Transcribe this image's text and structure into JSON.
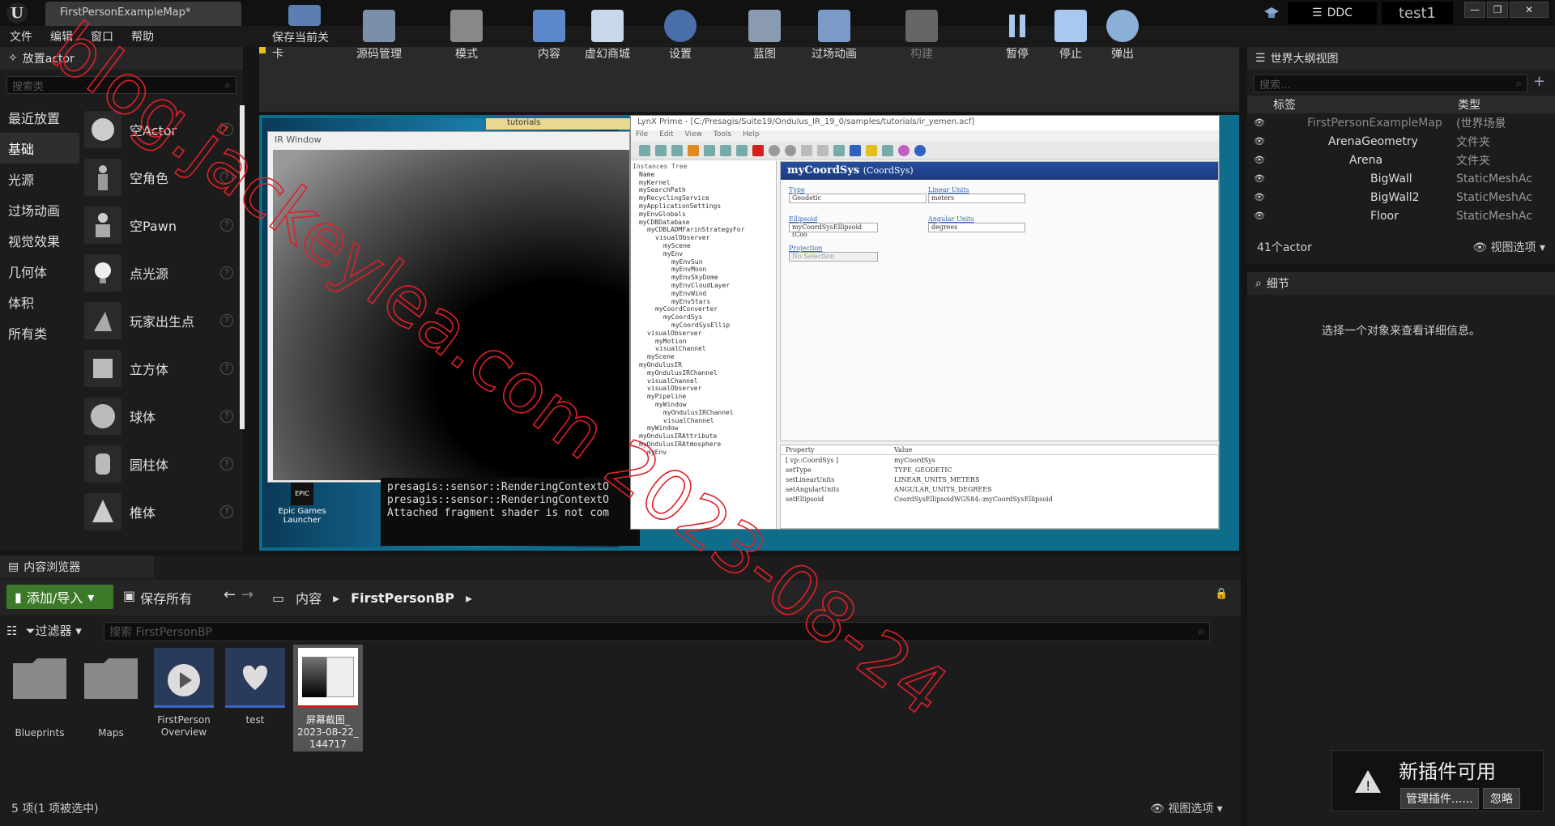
{
  "window": {
    "tab_title": "FirstPersonExampleMap*",
    "ddc": "DDC",
    "project": "test1"
  },
  "menu": [
    "文件",
    "编辑",
    "窗口",
    "帮助"
  ],
  "place_actor": {
    "tab": "放置actor",
    "search_placeholder": "搜索类",
    "categories": [
      "最近放置",
      "基础",
      "光源",
      "过场动画",
      "视觉效果",
      "几何体",
      "体积",
      "所有类"
    ],
    "selected_category": "基础",
    "actors": [
      "空Actor",
      "空角色",
      "空Pawn",
      "点光源",
      "玩家出生点",
      "立方体",
      "球体",
      "圆柱体",
      "椎体"
    ]
  },
  "toolbar": [
    "保存当前关卡",
    "源码管理",
    "模式",
    "内容",
    "虚幻商城",
    "设置",
    "蓝图",
    "过场动画",
    "构建",
    "暂停",
    "停止",
    "弹出"
  ],
  "viewport": {
    "desktop_tabs": [
      "tutorials"
    ],
    "ir_window_title": "IR Window",
    "epic_label": "Epic Games Launcher",
    "console_lines": [
      "presagis::sensor::RenderingContextO",
      "presagis::sensor::RenderingContextO",
      "Attached fragment shader is not com"
    ]
  },
  "lynx": {
    "title": "LynX Prime - [C:/Presagis/Suite19/Ondulus_IR_19_0/samples/tutorials/ir_yemen.acf]",
    "menu": [
      "File",
      "Edit",
      "View",
      "Tools",
      "Help"
    ],
    "tree_header": "Instances Tree",
    "tree": [
      "Name",
      "myKernel",
      "mySearchPath",
      "myRecyclingService",
      "myApplicationSettings",
      "myEnvGlobals",
      "myCDBDatabase",
      " myCDBLADMFarinStrategyFor",
      "  visualObserver",
      "   myScene",
      "   myEnv",
      "    myEnvSun",
      "    myEnvMoon",
      "    myEnvSkyDome",
      "    myEnvCloudLayer",
      "    myEnvWind",
      "    myEnvStars",
      "  myCoordConverter",
      "   myCoordSys",
      "    myCoordSysEllip",
      " visualObserver",
      "  myMotion",
      "  visualChannel",
      " myScene",
      "myOndulusIR",
      " myOndulusIRChannel",
      " visualChannel",
      " visualObserver",
      " myPipeline",
      "  myWindow",
      "   myOndulusIRChannel",
      "   visualChannel",
      " myWindow",
      "myOndulusIRAttribute",
      "myOndulusIRAtmosphere",
      " myEnv"
    ],
    "props_title": "myCoordSys",
    "props_type": "(CoordSys)",
    "fields": [
      {
        "label": "Type",
        "value": "Geodetic"
      },
      {
        "label": "Linear Units",
        "value": "meters"
      },
      {
        "label": "Ellipsoid",
        "value": "myCoordSysEllipsoid (Coo"
      },
      {
        "label": "Angular Units",
        "value": "degrees"
      },
      {
        "label": "Projection",
        "value": "No Selection"
      }
    ],
    "table_header": [
      "Property",
      "Value"
    ],
    "table": [
      [
        "[ vp::CoordSys ]",
        "myCoordSys"
      ],
      [
        "setType",
        "TYPE_GEODETIC"
      ],
      [
        "setLinearUnits",
        "LINEAR_UNITS_METERS"
      ],
      [
        "setAngularUnits",
        "ANGULAR_UNITS_DEGREES"
      ],
      [
        "setEllipsoid",
        "CoordSysEllipsoidWGS84::myCoordSysEllipsoid"
      ]
    ]
  },
  "outliner": {
    "tab": "世界大纲视图",
    "search_placeholder": "搜索...",
    "col_label": "标签",
    "col_type": "类型",
    "rows": [
      {
        "label": "FirstPersonExampleMap",
        "type": "(世界场景",
        "depth": 0
      },
      {
        "label": "ArenaGeometry",
        "type": "文件夹",
        "depth": 1
      },
      {
        "label": "Arena",
        "type": "文件夹",
        "depth": 2
      },
      {
        "label": "BigWall",
        "type": "StaticMeshAc",
        "depth": 3
      },
      {
        "label": "BigWall2",
        "type": "StaticMeshAc",
        "depth": 3
      },
      {
        "label": "Floor",
        "type": "StaticMeshAc",
        "depth": 3
      }
    ],
    "count": "41个actor",
    "view_options": "视图选项"
  },
  "details": {
    "tab": "细节",
    "message": "选择一个对象来查看详细信息。"
  },
  "content_browser": {
    "tab": "内容浏览器",
    "add_import": "添加/导入",
    "save_all": "保存所有",
    "path": [
      "内容",
      "FirstPersonBP"
    ],
    "filter": "过滤器",
    "search_placeholder": "搜索 FirstPersonBP",
    "assets": [
      {
        "name": "Blueprints"
      },
      {
        "name": "Maps"
      },
      {
        "name": "FirstPerson Overview"
      },
      {
        "name": "test"
      },
      {
        "name": "屏幕截图_ 2023-08-22_ 144717"
      }
    ],
    "status": "5 项(1 项被选中)",
    "view_options": "视图选项"
  },
  "toast": {
    "title": "新插件可用",
    "manage": "管理插件......",
    "ignore": "忽略"
  },
  "watermark": "blog.jackeylea.com 2023-08-24",
  "colors": {
    "accent_green": "#3c7a2a",
    "watermark": "#e0202a"
  }
}
